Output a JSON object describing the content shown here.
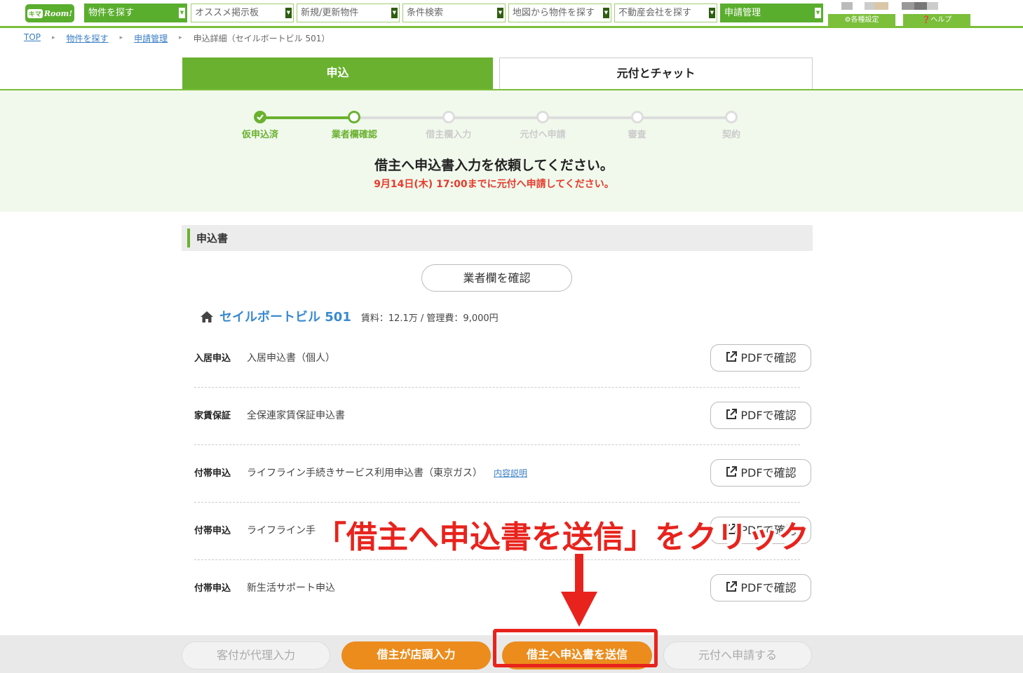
{
  "nav": {
    "logo_badge": "キマ",
    "logo_text": "Room!",
    "items": [
      {
        "label": "物件を探す",
        "active": true
      },
      {
        "label": "オススメ掲示板",
        "active": false
      },
      {
        "label": "新規/更新物件",
        "active": false
      },
      {
        "label": "条件検索",
        "active": false
      },
      {
        "label": "地図から物件を探す",
        "active": false
      },
      {
        "label": "不動産会社を探す",
        "active": false
      },
      {
        "label": "申請管理",
        "active": true
      }
    ],
    "settings_label": "各種設定",
    "help_label": "ヘルプ"
  },
  "breadcrumb": {
    "items": [
      "TOP",
      "物件を探す",
      "申請管理"
    ],
    "current": "申込詳細（セイルボートビル 501）"
  },
  "tabs": {
    "apply": "申込",
    "chat": "元付とチャット"
  },
  "progress": {
    "steps": [
      "仮申込済",
      "業者欄確認",
      "借主欄入力",
      "元付へ申請",
      "審査",
      "契約"
    ],
    "completed": 1,
    "current": 1,
    "message": "借主へ申込書入力を依頼してください。",
    "deadline": "9月14日(木) 17:00までに元付へ申請してください。"
  },
  "section": {
    "title": "申込書",
    "check_button": "業者欄を確認"
  },
  "property": {
    "name": "セイルボートビル 501",
    "info": "賃料：12.1万 / 管理費：9,000円"
  },
  "documents": [
    {
      "category": "入居申込",
      "name": "入居申込書（個人）",
      "link": "",
      "button": "PDFで確認"
    },
    {
      "category": "家賃保証",
      "name": "全保連家賃保証申込書",
      "link": "",
      "button": "PDFで確認"
    },
    {
      "category": "付帯申込",
      "name": "ライフライン手続きサービス利用申込書（東京ガス）",
      "link": "内容説明",
      "button": "PDFで確認"
    },
    {
      "category": "付帯申込",
      "name": "ライフライン手",
      "link": "",
      "button": "PDFで確認"
    },
    {
      "category": "付帯申込",
      "name": "新生活サポート申込",
      "link": "",
      "button": "PDFで確認"
    }
  ],
  "actions": {
    "proxy_input": "客付が代理入力",
    "store_input": "借主が店頭入力",
    "send_form": "借主へ申込書を送信",
    "submit": "元付へ申請する"
  },
  "annotation": {
    "text": "「借主へ申込書を送信」をクリック"
  },
  "colors": {
    "brand_green": "#6ab130",
    "orange": "#eb8c1c",
    "annotation_red": "#e8231d",
    "deadline_red": "#e53b2c",
    "link_blue": "#3a8ad0"
  }
}
